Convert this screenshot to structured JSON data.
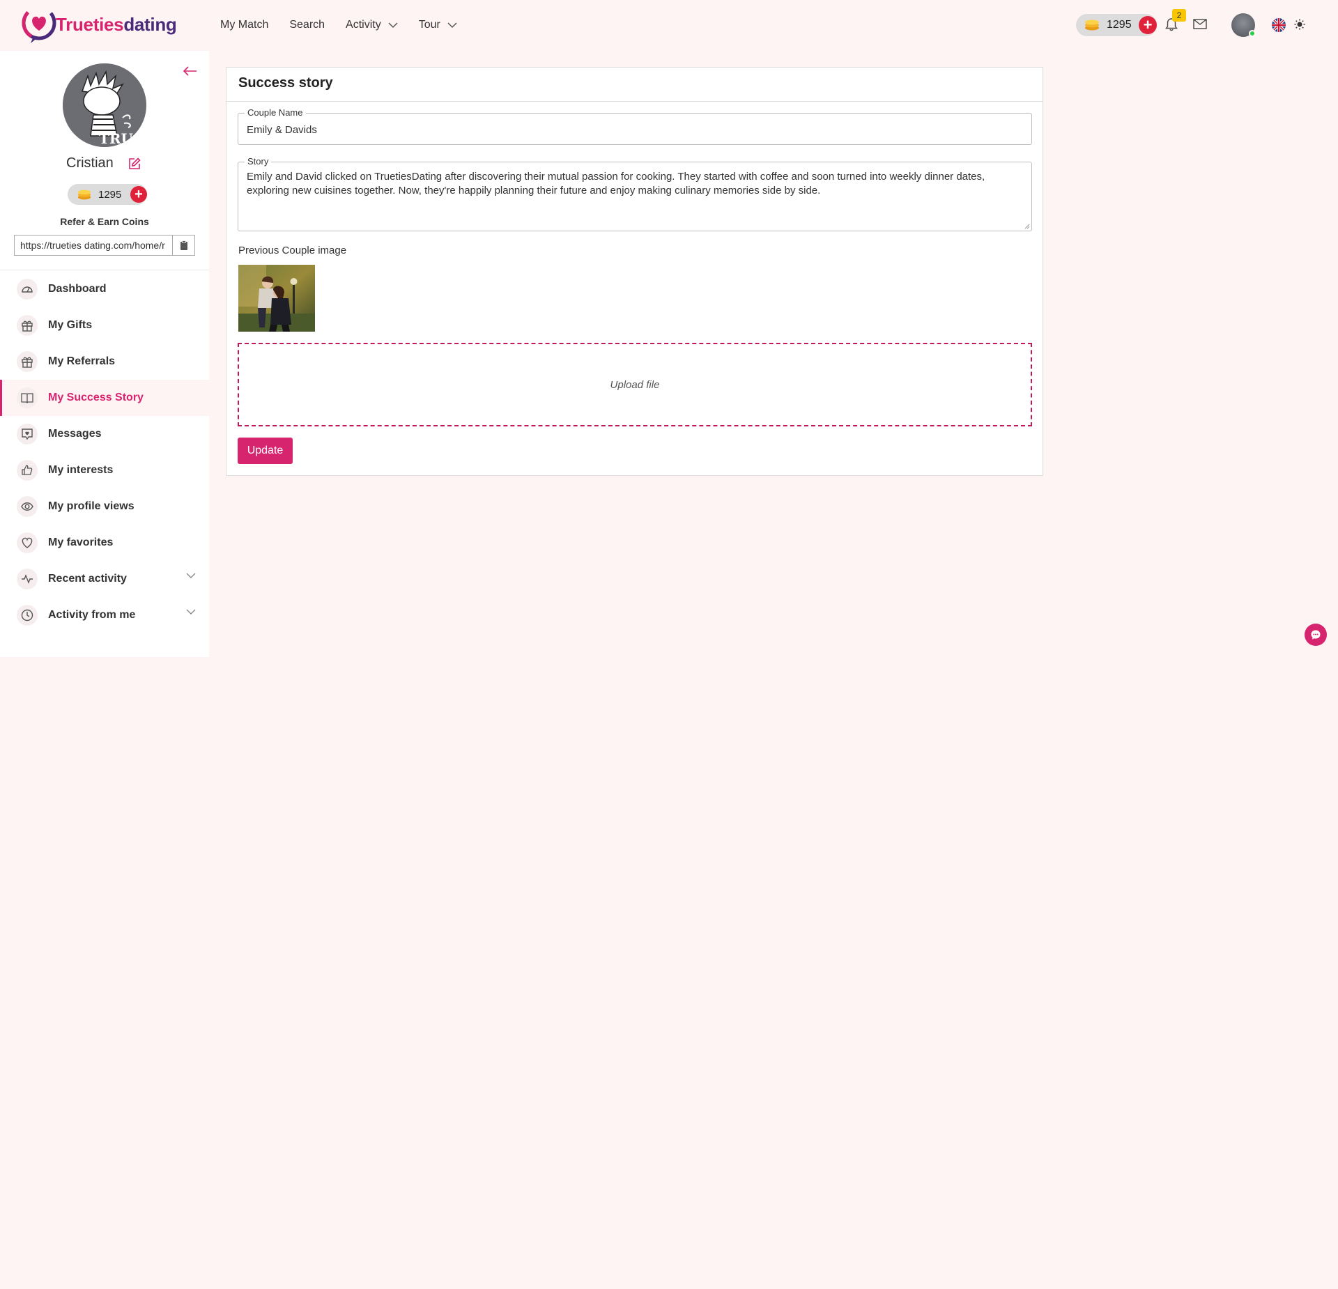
{
  "brand": {
    "name_part1": "Trueties",
    "name_part2": "dating",
    "brand_color": "#d6246e",
    "secondary_color": "#4a2a7a"
  },
  "nav": {
    "items": [
      {
        "label": "My Match",
        "dropdown": false
      },
      {
        "label": "Search",
        "dropdown": false
      },
      {
        "label": "Activity",
        "dropdown": true
      },
      {
        "label": "Tour",
        "dropdown": true
      }
    ]
  },
  "header": {
    "coins": "1295",
    "notification_count": "2",
    "language_flag": "uk-flag",
    "theme_icon": "sun-icon"
  },
  "sidebar": {
    "username": "Cristian",
    "avatar_text": "TRU",
    "coins": "1295",
    "refer_title": "Refer & Earn Coins",
    "refer_link": "https://trueties dating.com/home/r",
    "menu": [
      {
        "label": "Dashboard",
        "icon": "dashboard-icon",
        "active": false
      },
      {
        "label": "My Gifts",
        "icon": "gift-icon",
        "active": false
      },
      {
        "label": "My Referrals",
        "icon": "gift-icon",
        "active": false
      },
      {
        "label": "My Success Story",
        "icon": "book-icon",
        "active": true
      },
      {
        "label": "Messages",
        "icon": "message-heart-icon",
        "active": false
      },
      {
        "label": "My interests",
        "icon": "thumbs-up-icon",
        "active": false
      },
      {
        "label": "My profile views",
        "icon": "eye-icon",
        "active": false
      },
      {
        "label": "My favorites",
        "icon": "heart-icon",
        "active": false
      },
      {
        "label": "Recent activity",
        "icon": "activity-icon",
        "active": false,
        "expandable": true
      },
      {
        "label": "Activity from me",
        "icon": "clock-icon",
        "active": false,
        "expandable": true
      }
    ]
  },
  "main": {
    "title": "Success story",
    "couple_name_label": "Couple Name",
    "couple_name_value": "Emily & Davids",
    "story_label": "Story",
    "story_value": "Emily and David clicked on TruetiesDating after discovering their mutual passion for cooking. They started with coffee and soon turned into weekly dinner dates, exploring new cuisines together. Now, they're happily planning their future and enjoy making culinary memories side by side.",
    "previous_image_label": "Previous Couple image",
    "upload_text": "Upload file",
    "update_button": "Update"
  }
}
